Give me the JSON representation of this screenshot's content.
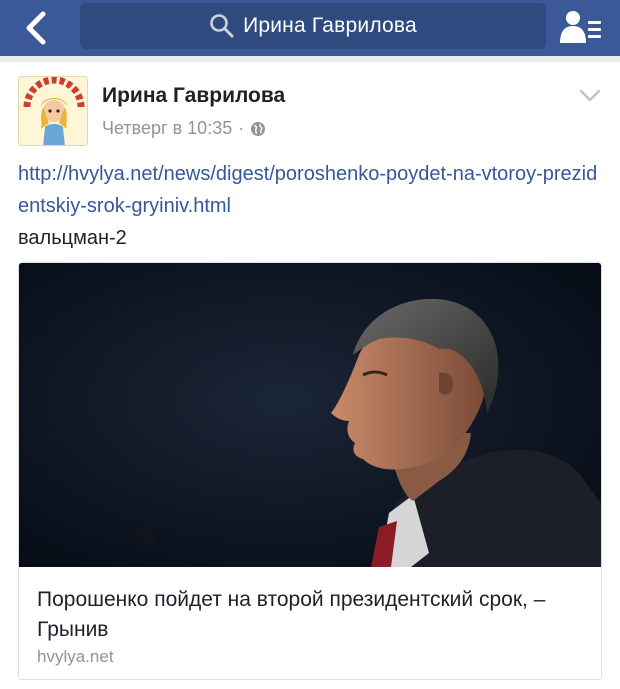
{
  "header": {
    "search_text": "Ирина Гаврилова",
    "icons": [
      "back-chevron-icon",
      "search-icon",
      "friends-list-icon"
    ],
    "bar_color": "#3b5998"
  },
  "post": {
    "author": "Ирина Гаврилова",
    "time": "Четверг в 10:35",
    "separator": "·",
    "privacy_icon": "globe-icon",
    "link_text": "http://hvylya.net/news/digest/poroshenko-poydet-na-vtoroy-prezidentskiy-srok-gryiniv.html",
    "message": "вальцман-2",
    "link_color": "#365899"
  },
  "shared_link": {
    "headline": "Порошенко пойдет на второй президентский срок, – Грынив",
    "domain": "hvylya.net",
    "image": "photo-of-man-in-profile-at-press-conference"
  }
}
